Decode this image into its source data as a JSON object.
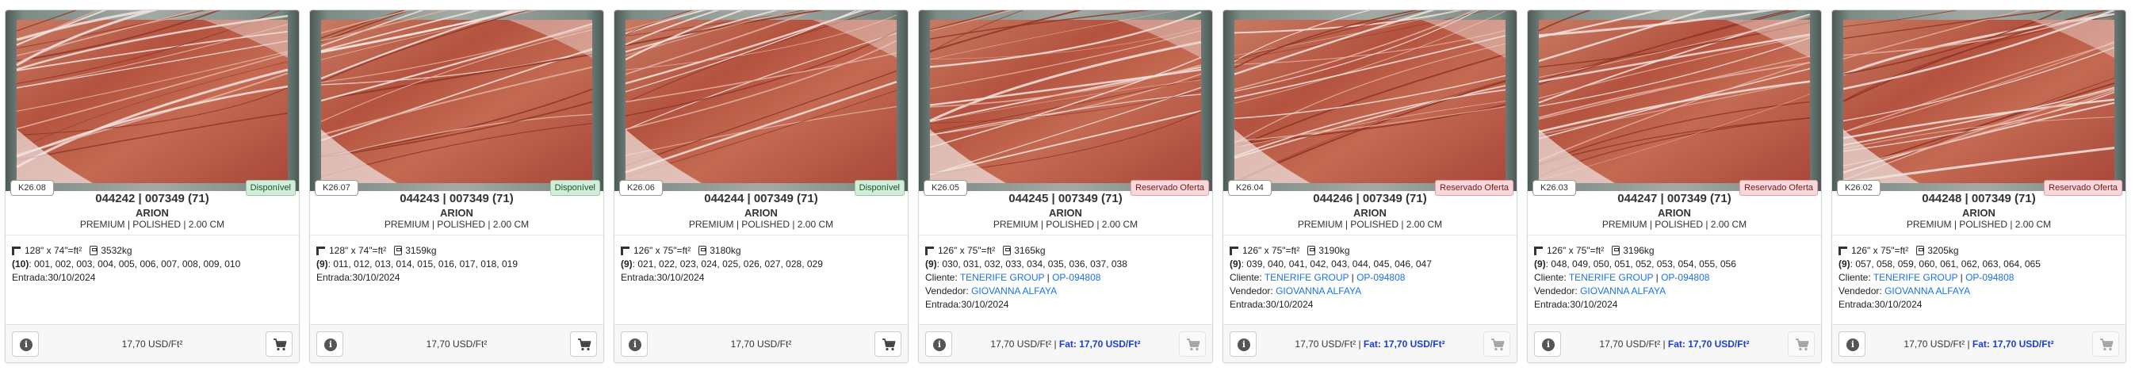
{
  "colors": {
    "available": "#d4edda",
    "reserved": "#f8d7da",
    "link": "#1a73e8",
    "fat": "#1a3fd1"
  },
  "cards": [
    {
      "tag": "K26.08",
      "status": "Disponível",
      "status_kind": "ok",
      "title": "044242 | 007349 (71)",
      "name": "ARION",
      "spec": "PREMIUM | POLISHED | 2.00 CM",
      "dims": "128\" x 74\"=ft²",
      "weight": "3532kg",
      "count": "(10)",
      "items": ": 001, 002, 003, 004, 005, 006, 007, 008, 009, 010",
      "client_label": "",
      "client": "",
      "op": "",
      "seller_label": "",
      "seller": "",
      "entry": "Entrada:30/10/2024",
      "price": "17,70 USD/Ft²",
      "fat": "",
      "cart_enabled": true
    },
    {
      "tag": "K26.07",
      "status": "Disponível",
      "status_kind": "ok",
      "title": "044243 | 007349 (71)",
      "name": "ARION",
      "spec": "PREMIUM | POLISHED | 2.00 CM",
      "dims": "128\" x 74\"=ft²",
      "weight": "3159kg",
      "count": "(9)",
      "items": ": 011, 012, 013, 014, 015, 016, 017, 018, 019",
      "client_label": "",
      "client": "",
      "op": "",
      "seller_label": "",
      "seller": "",
      "entry": "Entrada:30/10/2024",
      "price": "17,70 USD/Ft²",
      "fat": "",
      "cart_enabled": true
    },
    {
      "tag": "K26.06",
      "status": "Disponível",
      "status_kind": "ok",
      "title": "044244 | 007349 (71)",
      "name": "ARION",
      "spec": "PREMIUM | POLISHED | 2.00 CM",
      "dims": "126\" x 75\"=ft²",
      "weight": "3180kg",
      "count": "(9)",
      "items": ": 021, 022, 023, 024, 025, 026, 027, 028, 029",
      "client_label": "",
      "client": "",
      "op": "",
      "seller_label": "",
      "seller": "",
      "entry": "Entrada:30/10/2024",
      "price": "17,70 USD/Ft²",
      "fat": "",
      "cart_enabled": true
    },
    {
      "tag": "K26.05",
      "status": "Reservado Oferta",
      "status_kind": "res",
      "title": "044245 | 007349 (71)",
      "name": "ARION",
      "spec": "PREMIUM | POLISHED | 2.00 CM",
      "dims": "126\" x 75\"=ft²",
      "weight": "3165kg",
      "count": "(9)",
      "items": ": 030, 031, 032, 033, 034, 035, 036, 037, 038",
      "client_label": "Cliente: ",
      "client": "TENERIFE GROUP",
      "op": "OP-094808",
      "seller_label": "Vendedor: ",
      "seller": "GIOVANNA ALFAYA",
      "entry": "Entrada:30/10/2024",
      "price": "17,70 USD/Ft²",
      "fat": "Fat: 17,70 USD/Ft²",
      "cart_enabled": false
    },
    {
      "tag": "K26.04",
      "status": "Reservado Oferta",
      "status_kind": "res",
      "title": "044246 | 007349 (71)",
      "name": "ARION",
      "spec": "PREMIUM | POLISHED | 2.00 CM",
      "dims": "126\" x 75\"=ft²",
      "weight": "3190kg",
      "count": "(9)",
      "items": ": 039, 040, 041, 042, 043, 044, 045, 046, 047",
      "client_label": "Cliente: ",
      "client": "TENERIFE GROUP",
      "op": "OP-094808",
      "seller_label": "Vendedor: ",
      "seller": "GIOVANNA ALFAYA",
      "entry": "Entrada:30/10/2024",
      "price": "17,70 USD/Ft²",
      "fat": "Fat: 17,70 USD/Ft²",
      "cart_enabled": false
    },
    {
      "tag": "K26.03",
      "status": "Reservado Oferta",
      "status_kind": "res",
      "title": "044247 | 007349 (71)",
      "name": "ARION",
      "spec": "PREMIUM | POLISHED | 2.00 CM",
      "dims": "126\" x 75\"=ft²",
      "weight": "3196kg",
      "count": "(9)",
      "items": ": 048, 049, 050, 051, 052, 053, 054, 055, 056",
      "client_label": "Cliente: ",
      "client": "TENERIFE GROUP",
      "op": "OP-094808",
      "seller_label": "Vendedor: ",
      "seller": "GIOVANNA ALFAYA",
      "entry": "Entrada:30/10/2024",
      "price": "17,70 USD/Ft²",
      "fat": "Fat: 17,70 USD/Ft²",
      "cart_enabled": false
    },
    {
      "tag": "K26.02",
      "status": "Reservado Oferta",
      "status_kind": "res",
      "title": "044248 | 007349 (71)",
      "name": "ARION",
      "spec": "PREMIUM | POLISHED | 2.00 CM",
      "dims": "126\" x 75\"=ft²",
      "weight": "3205kg",
      "count": "(9)",
      "items": ": 057, 058, 059, 060, 061, 062, 063, 064, 065",
      "client_label": "Cliente: ",
      "client": "TENERIFE GROUP",
      "op": "OP-094808",
      "seller_label": "Vendedor: ",
      "seller": "GIOVANNA ALFAYA",
      "entry": "Entrada:30/10/2024",
      "price": "17,70 USD/Ft²",
      "fat": "Fat: 17,70 USD/Ft²",
      "cart_enabled": false
    }
  ]
}
